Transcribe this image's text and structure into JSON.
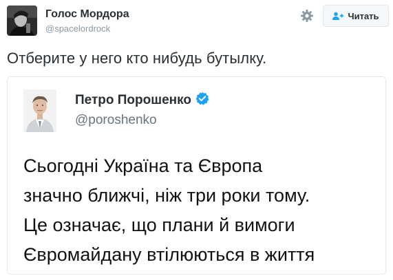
{
  "header": {
    "author_name": "Голос Мордора",
    "author_handle": "@spacelordrock",
    "follow_label": "Читать"
  },
  "tweet": {
    "text": "Отберите у него кто нибудь бутылку."
  },
  "quoted_tweet": {
    "author_name": "Петро Порошенко",
    "author_handle": "@poroshenko",
    "verified": true,
    "body_lines": [
      "Сьогодні Україна та Європа",
      "значно ближчі, ніж три роки тому.",
      "Це означає, що плани й вимоги",
      "Євромайдану втілюються в життя"
    ]
  },
  "icons": {
    "settings": "gear-icon",
    "follow": "add-user-icon",
    "verified": "verified-badge-icon"
  },
  "colors": {
    "verified_blue": "#1da1f2",
    "text": "#292f33",
    "muted": "#8899a6",
    "border": "#e1e8ed"
  }
}
